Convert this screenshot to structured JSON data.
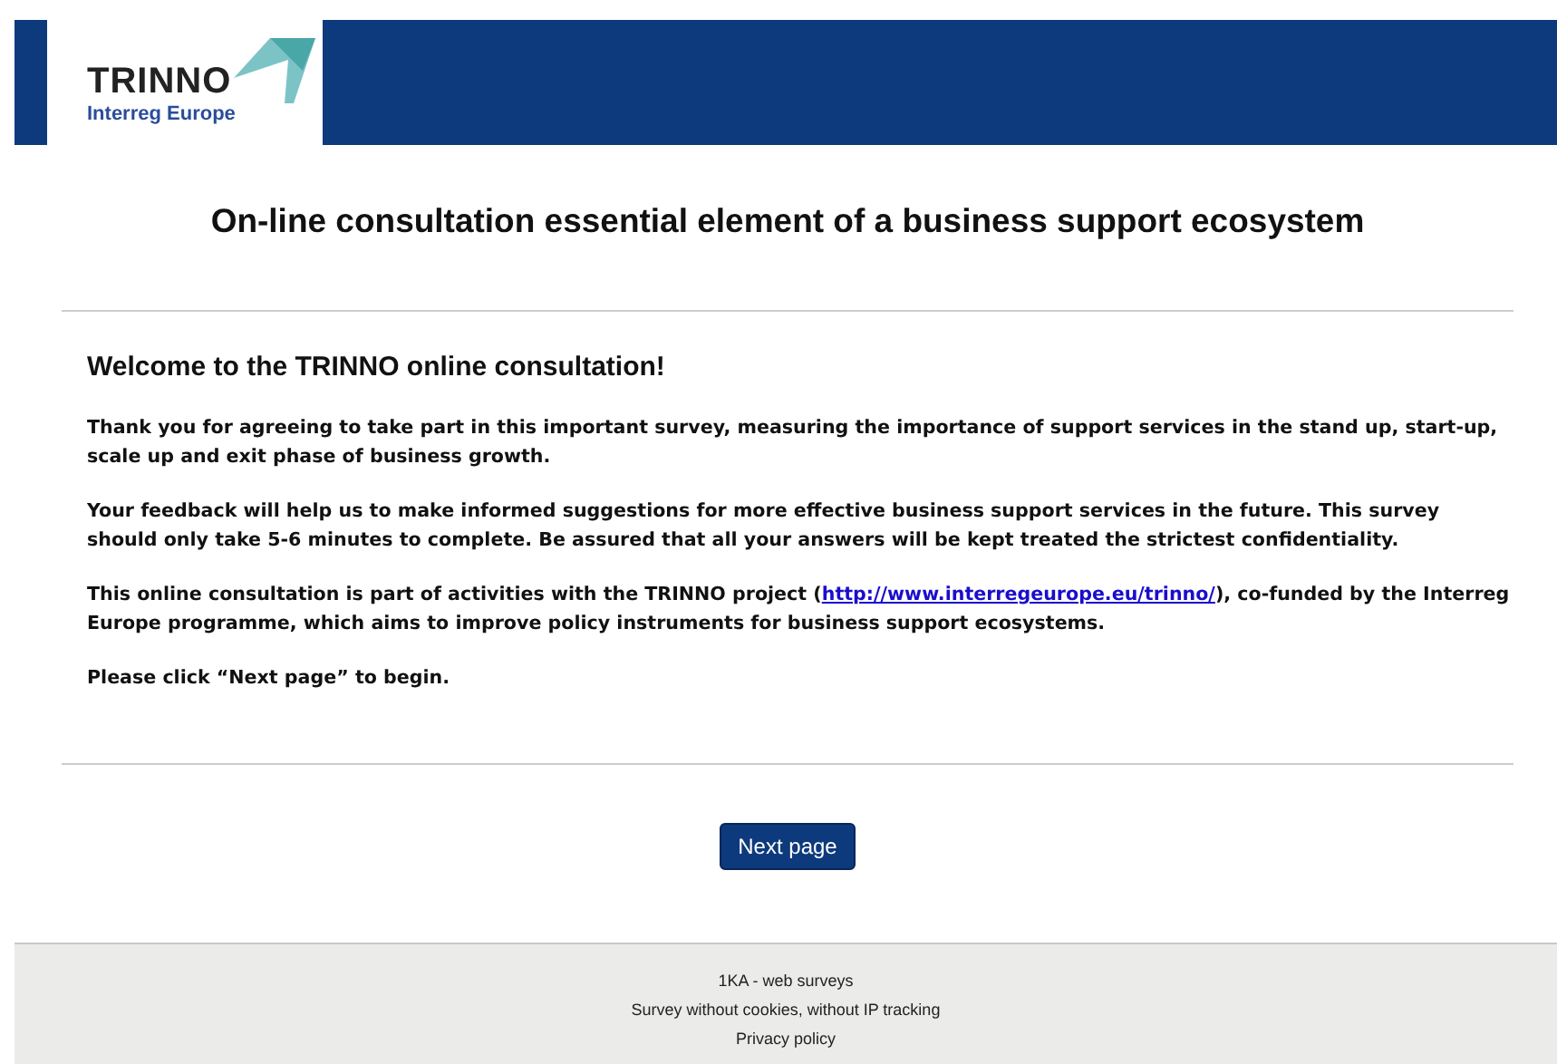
{
  "header": {
    "logo": {
      "name": "TRINNO",
      "subtitle": "Interreg Europe"
    }
  },
  "survey_title": "On-line consultation essential element of a business support ecosystem",
  "intro": {
    "heading": "Welcome to the TRINNO online consultation!",
    "paragraphs": [
      {
        "text": "Thank you for agreeing to take part in this important survey, measuring the importance of support services in the stand up, start-up, scale up and exit phase of business growth."
      },
      {
        "text": "Your feedback will help us to make informed suggestions for more effective business support services in the future. This survey should only take 5-6 minutes to complete. Be assured that all your answers will be kept treated the strictest confidentiality."
      },
      {
        "text": "This online consultation is part of activities with the TRINNO project (",
        "link": "http://www.interregeurope.eu/trinno/",
        "after": "), co-funded by the Interreg Europe programme, which aims to improve policy instruments for business support ecosystems."
      },
      {
        "text": "Please click “Next page” to begin."
      }
    ]
  },
  "next_button": "Next page",
  "footer": [
    "1KA - web surveys",
    "Survey without cookies, without IP tracking",
    "Privacy policy"
  ]
}
